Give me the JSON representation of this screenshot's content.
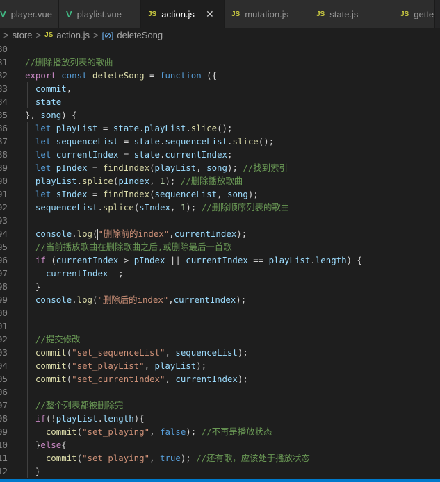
{
  "tabs": [
    {
      "icon": "V",
      "label": "player.vue",
      "kind": "vue"
    },
    {
      "icon": "V",
      "label": "playlist.vue",
      "kind": "vue"
    },
    {
      "icon": "JS",
      "label": "action.js",
      "kind": "js",
      "close": "✕"
    },
    {
      "icon": "JS",
      "label": "mutation.js",
      "kind": "js"
    },
    {
      "icon": "JS",
      "label": "state.js",
      "kind": "js"
    },
    {
      "icon": "JS",
      "label": "gette",
      "kind": "js"
    }
  ],
  "breadcrumb": {
    "folder": "store",
    "file_icon": "JS",
    "file": "action.js",
    "symbol_icon": "[⊘]",
    "symbol": "deleteSong",
    "separator": ">"
  },
  "lines": [
    {
      "num": "80",
      "tokens": []
    },
    {
      "num": "81",
      "tokens": [
        [
          "com",
          "//删除播放列表的歌曲"
        ]
      ]
    },
    {
      "num": "82",
      "tokens": [
        [
          "ctl",
          "export "
        ],
        [
          "kw",
          "const "
        ],
        [
          "fn",
          "deleteSong"
        ],
        [
          "p",
          " = "
        ],
        [
          "kw",
          "function"
        ],
        [
          "p",
          " ({"
        ]
      ]
    },
    {
      "num": "83",
      "tokens": [
        [
          "p",
          "  "
        ],
        [
          "var",
          "commit"
        ],
        [
          "p",
          ","
        ]
      ]
    },
    {
      "num": "84",
      "tokens": [
        [
          "p",
          "  "
        ],
        [
          "var",
          "state"
        ]
      ]
    },
    {
      "num": "85",
      "tokens": [
        [
          "p",
          "}, "
        ],
        [
          "var",
          "song"
        ],
        [
          "p",
          ") {"
        ]
      ]
    },
    {
      "num": "86",
      "tokens": [
        [
          "p",
          "  "
        ],
        [
          "kw",
          "let "
        ],
        [
          "var",
          "playList"
        ],
        [
          "p",
          " = "
        ],
        [
          "var",
          "state"
        ],
        [
          "p",
          "."
        ],
        [
          "var",
          "playList"
        ],
        [
          "p",
          "."
        ],
        [
          "fn",
          "slice"
        ],
        [
          "p",
          "();"
        ]
      ]
    },
    {
      "num": "87",
      "tokens": [
        [
          "p",
          "  "
        ],
        [
          "kw",
          "let "
        ],
        [
          "var",
          "sequenceList"
        ],
        [
          "p",
          " = "
        ],
        [
          "var",
          "state"
        ],
        [
          "p",
          "."
        ],
        [
          "var",
          "sequenceList"
        ],
        [
          "p",
          "."
        ],
        [
          "fn",
          "slice"
        ],
        [
          "p",
          "();"
        ]
      ]
    },
    {
      "num": "88",
      "tokens": [
        [
          "p",
          "  "
        ],
        [
          "kw",
          "let "
        ],
        [
          "var",
          "currentIndex"
        ],
        [
          "p",
          " = "
        ],
        [
          "var",
          "state"
        ],
        [
          "p",
          "."
        ],
        [
          "var",
          "currentIndex"
        ],
        [
          "p",
          ";"
        ]
      ]
    },
    {
      "num": "89",
      "tokens": [
        [
          "p",
          "  "
        ],
        [
          "kw",
          "let "
        ],
        [
          "var",
          "pIndex"
        ],
        [
          "p",
          " = "
        ],
        [
          "fn",
          "findIndex"
        ],
        [
          "p",
          "("
        ],
        [
          "var",
          "playList"
        ],
        [
          "p",
          ", "
        ],
        [
          "var",
          "song"
        ],
        [
          "p",
          "); "
        ],
        [
          "com",
          "//找到索引"
        ]
      ]
    },
    {
      "num": "90",
      "tokens": [
        [
          "p",
          "  "
        ],
        [
          "var",
          "playList"
        ],
        [
          "p",
          "."
        ],
        [
          "fn",
          "splice"
        ],
        [
          "p",
          "("
        ],
        [
          "var",
          "pIndex"
        ],
        [
          "p",
          ", "
        ],
        [
          "num",
          "1"
        ],
        [
          "p",
          "); "
        ],
        [
          "com",
          "//删除播放歌曲"
        ]
      ]
    },
    {
      "num": "91",
      "tokens": [
        [
          "p",
          "  "
        ],
        [
          "kw",
          "let "
        ],
        [
          "var",
          "sIndex"
        ],
        [
          "p",
          " = "
        ],
        [
          "fn",
          "findIndex"
        ],
        [
          "p",
          "("
        ],
        [
          "var",
          "sequenceList"
        ],
        [
          "p",
          ", "
        ],
        [
          "var",
          "song"
        ],
        [
          "p",
          ");"
        ]
      ]
    },
    {
      "num": "92",
      "tokens": [
        [
          "p",
          "  "
        ],
        [
          "var",
          "sequenceList"
        ],
        [
          "p",
          "."
        ],
        [
          "fn",
          "splice"
        ],
        [
          "p",
          "("
        ],
        [
          "var",
          "sIndex"
        ],
        [
          "p",
          ", "
        ],
        [
          "num",
          "1"
        ],
        [
          "p",
          "); "
        ],
        [
          "com",
          "//删除顺序列表的歌曲"
        ]
      ]
    },
    {
      "num": "93",
      "tokens": []
    },
    {
      "num": "94",
      "tokens": [
        [
          "p",
          "  "
        ],
        [
          "var",
          "console"
        ],
        [
          "p",
          "."
        ],
        [
          "fn",
          "log"
        ],
        [
          "p",
          "("
        ],
        [
          "cursor",
          ""
        ],
        [
          "str",
          "\"删除前的index\""
        ],
        [
          "p",
          ","
        ],
        [
          "var",
          "currentIndex"
        ],
        [
          "p",
          ");"
        ]
      ]
    },
    {
      "num": "95",
      "tokens": [
        [
          "p",
          "  "
        ],
        [
          "com",
          "//当前播放歌曲在删除歌曲之后,或删除最后一首歌"
        ]
      ]
    },
    {
      "num": "96",
      "tokens": [
        [
          "p",
          "  "
        ],
        [
          "ctl",
          "if"
        ],
        [
          "p",
          " ("
        ],
        [
          "var",
          "currentIndex"
        ],
        [
          "p",
          " > "
        ],
        [
          "var",
          "pIndex"
        ],
        [
          "p",
          " || "
        ],
        [
          "var",
          "currentIndex"
        ],
        [
          "p",
          " == "
        ],
        [
          "var",
          "playList"
        ],
        [
          "p",
          "."
        ],
        [
          "var",
          "length"
        ],
        [
          "p",
          ") {"
        ]
      ]
    },
    {
      "num": "97",
      "tokens": [
        [
          "p",
          "    "
        ],
        [
          "var",
          "currentIndex"
        ],
        [
          "p",
          "--;"
        ]
      ]
    },
    {
      "num": "98",
      "tokens": [
        [
          "p",
          "  }"
        ]
      ]
    },
    {
      "num": "99",
      "tokens": [
        [
          "p",
          "  "
        ],
        [
          "var",
          "console"
        ],
        [
          "p",
          "."
        ],
        [
          "fn",
          "log"
        ],
        [
          "p",
          "("
        ],
        [
          "str",
          "\"删除后的index\""
        ],
        [
          "p",
          ","
        ],
        [
          "var",
          "currentIndex"
        ],
        [
          "p",
          ");"
        ]
      ]
    },
    {
      "num": "00",
      "tokens": []
    },
    {
      "num": "01",
      "tokens": []
    },
    {
      "num": "02",
      "tokens": [
        [
          "p",
          "  "
        ],
        [
          "com",
          "//提交修改"
        ]
      ]
    },
    {
      "num": "03",
      "tokens": [
        [
          "p",
          "  "
        ],
        [
          "fn",
          "commit"
        ],
        [
          "p",
          "("
        ],
        [
          "str",
          "\"set_sequenceList\""
        ],
        [
          "p",
          ", "
        ],
        [
          "var",
          "sequenceList"
        ],
        [
          "p",
          ");"
        ]
      ]
    },
    {
      "num": "04",
      "tokens": [
        [
          "p",
          "  "
        ],
        [
          "fn",
          "commit"
        ],
        [
          "p",
          "("
        ],
        [
          "str",
          "\"set_playList\""
        ],
        [
          "p",
          ", "
        ],
        [
          "var",
          "playList"
        ],
        [
          "p",
          ");"
        ]
      ]
    },
    {
      "num": "05",
      "tokens": [
        [
          "p",
          "  "
        ],
        [
          "fn",
          "commit"
        ],
        [
          "p",
          "("
        ],
        [
          "str",
          "\"set_currentIndex\""
        ],
        [
          "p",
          ", "
        ],
        [
          "var",
          "currentIndex"
        ],
        [
          "p",
          ");"
        ]
      ]
    },
    {
      "num": "06",
      "tokens": []
    },
    {
      "num": "07",
      "tokens": [
        [
          "p",
          "  "
        ],
        [
          "com",
          "//整个列表都被删除完"
        ]
      ]
    },
    {
      "num": "08",
      "tokens": [
        [
          "p",
          "  "
        ],
        [
          "ctl",
          "if"
        ],
        [
          "p",
          "(!"
        ],
        [
          "var",
          "playList"
        ],
        [
          "p",
          "."
        ],
        [
          "var",
          "length"
        ],
        [
          "p",
          "){"
        ]
      ]
    },
    {
      "num": "09",
      "tokens": [
        [
          "p",
          "    "
        ],
        [
          "fn",
          "commit"
        ],
        [
          "p",
          "("
        ],
        [
          "str",
          "\"set_playing\""
        ],
        [
          "p",
          ", "
        ],
        [
          "kw",
          "false"
        ],
        [
          "p",
          "); "
        ],
        [
          "com",
          "//不再是播放状态"
        ]
      ]
    },
    {
      "num": "10",
      "tokens": [
        [
          "p",
          "  }"
        ],
        [
          "ctl",
          "else"
        ],
        [
          "p",
          "{"
        ]
      ]
    },
    {
      "num": "11",
      "tokens": [
        [
          "p",
          "    "
        ],
        [
          "fn",
          "commit"
        ],
        [
          "p",
          "("
        ],
        [
          "str",
          "\"set_playing\""
        ],
        [
          "p",
          ", "
        ],
        [
          "kw",
          "true"
        ],
        [
          "p",
          "); "
        ],
        [
          "com",
          "//还有歌，应该处于播放状态"
        ]
      ]
    },
    {
      "num": "12",
      "tokens": [
        [
          "p",
          "  }"
        ]
      ]
    }
  ]
}
